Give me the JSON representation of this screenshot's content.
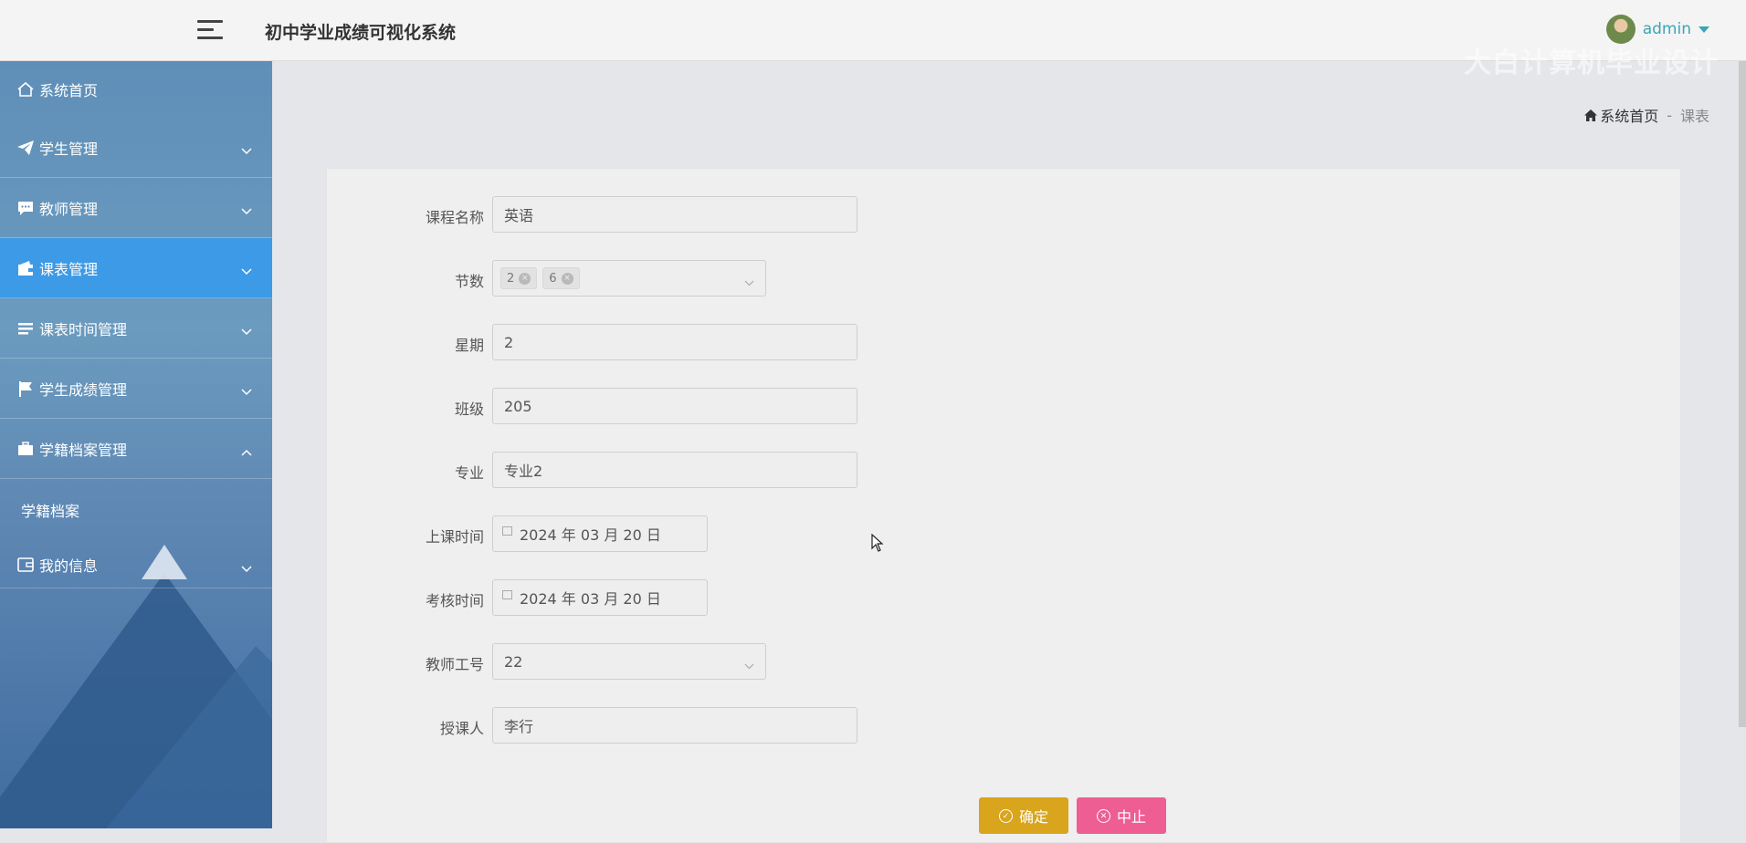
{
  "header": {
    "app_title": "初中学业成绩可视化系统",
    "user_name": "admin",
    "watermark": "大白计算机毕业设计"
  },
  "sidebar": {
    "items": [
      {
        "label": "系统首页",
        "icon": "home-icon"
      },
      {
        "label": "学生管理",
        "icon": "paper-plane-icon"
      },
      {
        "label": "教师管理",
        "icon": "comment-icon"
      },
      {
        "label": "课表管理",
        "icon": "wallet-icon"
      },
      {
        "label": "课表时间管理",
        "icon": "list-icon"
      },
      {
        "label": "学生成绩管理",
        "icon": "flag-icon"
      },
      {
        "label": "学籍档案管理",
        "icon": "briefcase-icon"
      },
      {
        "label": "我的信息",
        "icon": "card-icon"
      }
    ],
    "sub_items": [
      {
        "label": "学籍档案"
      }
    ]
  },
  "breadcrumb": {
    "home": "系统首页",
    "separator": "-",
    "current": "课表"
  },
  "form": {
    "course_name": {
      "label": "课程名称",
      "value": "英语"
    },
    "sessions": {
      "label": "节数",
      "tags": [
        "2",
        "6"
      ]
    },
    "weekday": {
      "label": "星期",
      "value": "2"
    },
    "class": {
      "label": "班级",
      "value": "205"
    },
    "major": {
      "label": "专业",
      "value": "专业2"
    },
    "class_time": {
      "label": "上课时间",
      "value": "2024 年 03 月 20 日"
    },
    "exam_time": {
      "label": "考核时间",
      "value": "2024 年 03 月 20 日"
    },
    "teacher_id": {
      "label": "教师工号",
      "value": "22"
    },
    "lecturer": {
      "label": "授课人",
      "value": "李行"
    },
    "confirm_label": "确定",
    "cancel_label": "中止"
  },
  "colors": {
    "sidebar_active": "#3d9ae6",
    "confirm_button": "#d9a51c",
    "cancel_button": "#ee5e92",
    "username": "#3aa6b5"
  }
}
